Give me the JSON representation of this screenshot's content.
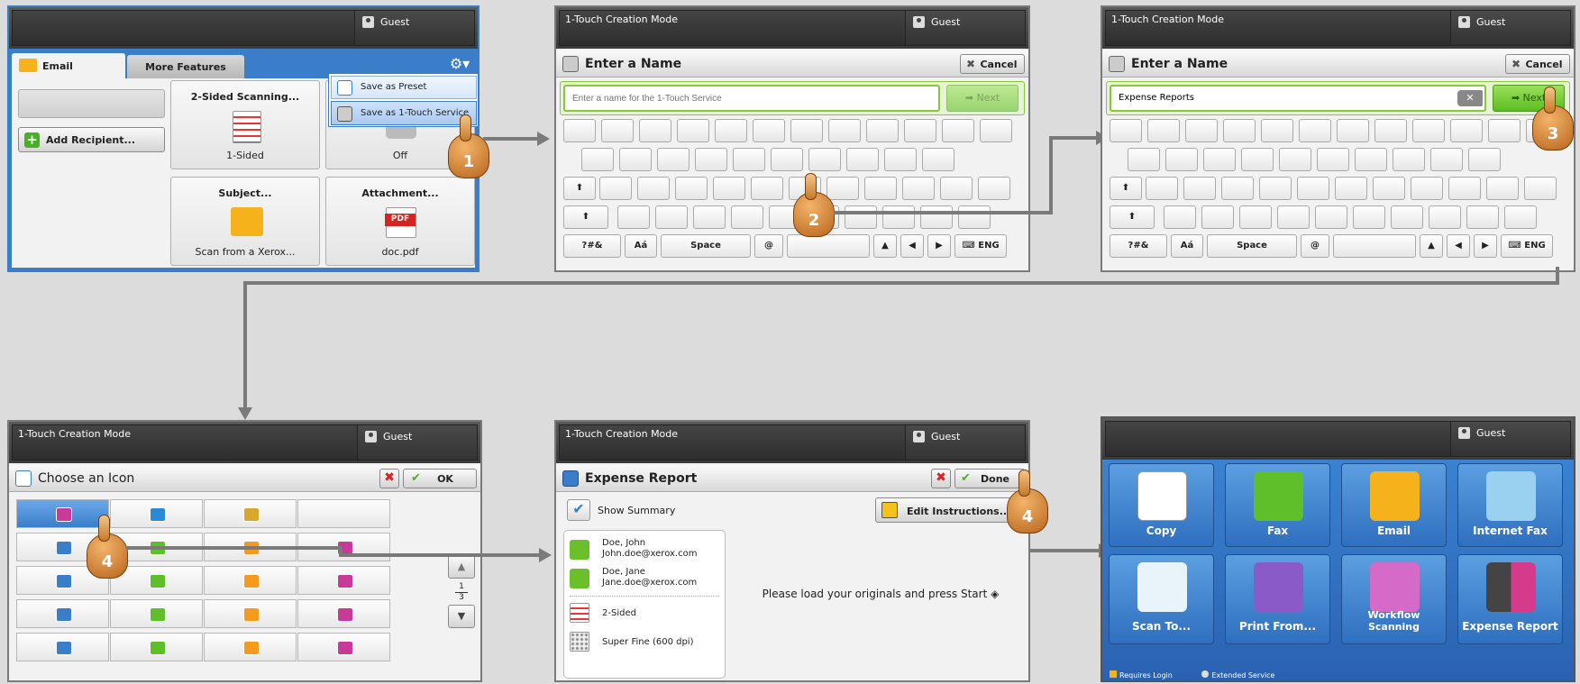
{
  "p1": {
    "guest": "Guest",
    "tab_email": "Email",
    "tab_more": "More Features",
    "menu": [
      "Save as Preset",
      "Save as 1-Touch Service"
    ],
    "add_recipient": "Add Recipient...",
    "tiles": [
      {
        "label": "2-Sided Scanning...",
        "value": "1-Sided"
      },
      {
        "label": "",
        "value": "Off"
      },
      {
        "label": "Subject...",
        "value": "Scan from a Xerox..."
      },
      {
        "label": "Attachment...",
        "value": "doc.pdf"
      }
    ],
    "pdf_text": "PDF"
  },
  "p2": {
    "mode": "1-Touch Creation Mode",
    "guest": "Guest",
    "title": "Enter a Name",
    "cancel": "Cancel",
    "placeholder": "Enter a name for the 1-Touch Service",
    "next": "Next",
    "keys": {
      "sym": "?#&",
      "accent": "Aá",
      "space": "Space",
      "at": "@",
      "lang": "ENG"
    }
  },
  "p3": {
    "mode": "1-Touch Creation Mode",
    "guest": "Guest",
    "title": "Enter a Name",
    "cancel": "Cancel",
    "value": "Expense Reports",
    "next": "Next",
    "keys": {
      "sym": "?#&",
      "accent": "Aá",
      "space": "Space",
      "at": "@",
      "lang": "ENG"
    }
  },
  "p4": {
    "mode": "1-Touch Creation Mode",
    "guest": "Guest",
    "title": "Choose an Icon",
    "ok": "OK",
    "page_num": "1",
    "page_den": "3"
  },
  "p5": {
    "mode": "1-Touch Creation Mode",
    "guest": "Guest",
    "title": "Expense Report",
    "done": "Done",
    "show_summary": "Show Summary",
    "edit_instructions": "Edit Instructions...",
    "recipients": [
      {
        "name": "Doe, John",
        "email": "John.doe@xerox.com"
      },
      {
        "name": "Doe, Jane",
        "email": "Jane.doe@xerox.com"
      }
    ],
    "settings": [
      "2-Sided",
      "Super Fine (600 dpi)"
    ],
    "message": "Please load your originals and press Start"
  },
  "p6": {
    "guest": "Guest",
    "apps": [
      "Copy",
      "Fax",
      "Email",
      "Internet Fax",
      "Scan To...",
      "Print From...",
      "Workflow Scanning",
      "Expense Report"
    ],
    "legend": [
      "Requires Login",
      "Extended Service"
    ]
  },
  "steps": [
    "1",
    "2",
    "3",
    "4",
    "4"
  ],
  "colors": {
    "accent_blue": "#3a7ec9",
    "next_green": "#5bbd22",
    "hand": "#c67a2a",
    "connector": "#7a7a7a"
  }
}
